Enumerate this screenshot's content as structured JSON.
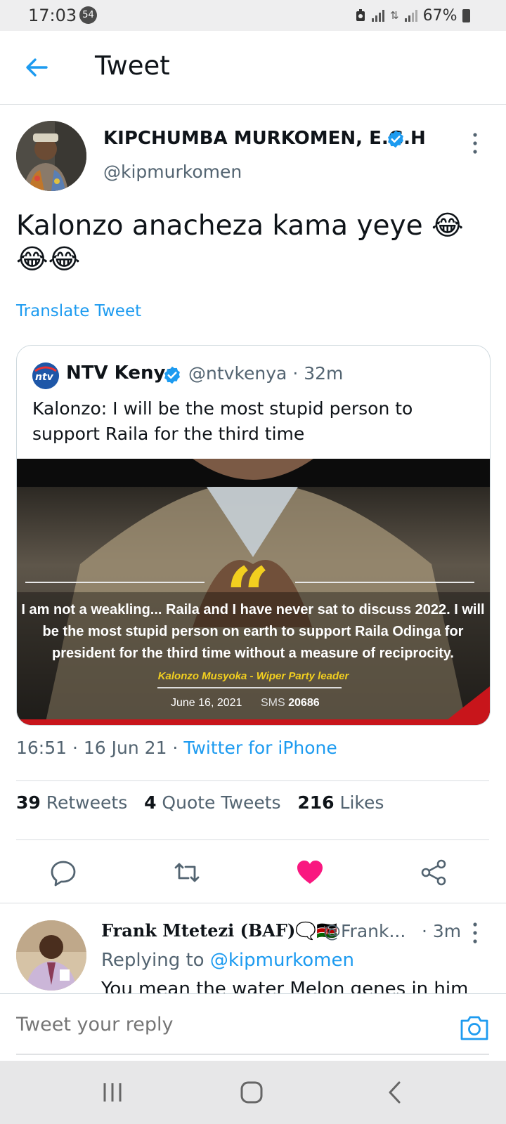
{
  "status_bar": {
    "time": "17:03",
    "notif_count": "54",
    "battery": "67%"
  },
  "header": {
    "title": "Tweet"
  },
  "tweet": {
    "author_name": "KIPCHUMBA MURKOMEN, E.G.H",
    "author_handle": "@kipmurkomen",
    "text": "Kalonzo anacheza kama yeye 😂😂😂",
    "translate_label": "Translate Tweet",
    "time": "16:51",
    "date": "16 Jun 21",
    "source": "Twitter for iPhone",
    "retweets_count": "39",
    "retweets_label": "Retweets",
    "quotes_count": "4",
    "quotes_label": "Quote Tweets",
    "likes_count": "216",
    "likes_label": "Likes"
  },
  "quoted": {
    "name": "NTV Kenya",
    "handle": "@ntvkenya",
    "age": "32m",
    "text": "Kalonzo: I will be the most stupid person to support Raila  for the third time",
    "avatar_text": "ntv",
    "image": {
      "quote": "I am not a weakling... Raila and I have never sat to discuss 2022. I will be the most stupid person on earth to support Raila Odinga for president for the third time without a measure of reciprocity.",
      "attribution": "Kalonzo Musyoka - Wiper Party leader",
      "date": "June 16, 2021",
      "sms_label": "SMS",
      "sms_number": "20686"
    }
  },
  "reply": {
    "name": "Frank Mtetezi",
    "name_tag": "(BAF)",
    "emoji": "🗨️🇰🇪",
    "handle": "@Frank...",
    "age": "· 3m",
    "replying_prefix": "Replying to",
    "replying_handle": "@kipmurkomen",
    "text": "You mean the water Melon genes in him"
  },
  "compose": {
    "placeholder": "Tweet your reply"
  },
  "colors": {
    "accent": "#1d9bf0",
    "like": "#f91880",
    "brand_yellow": "#f2cf1f",
    "brand_red": "#c8151b"
  }
}
